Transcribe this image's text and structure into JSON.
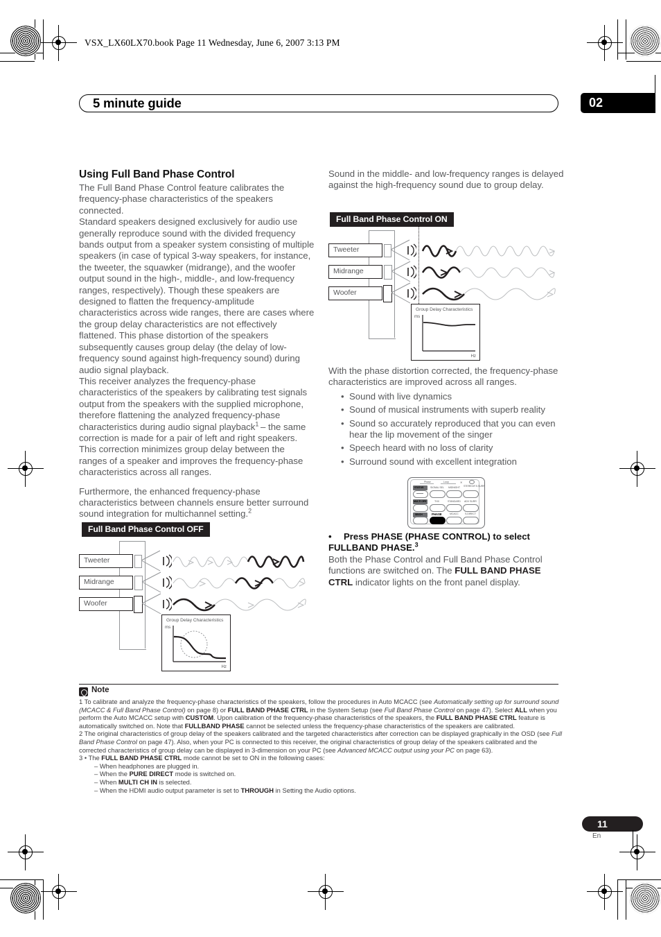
{
  "book_header": "VSX_LX60LX70.book  Page 11  Wednesday, June 6, 2007  3:13 PM",
  "chapter": {
    "title": "5 minute guide",
    "number": "02"
  },
  "page_footer": {
    "number": "11",
    "lang": "En"
  },
  "left_column": {
    "heading": "Using Full Band Phase Control",
    "paragraphs": [
      "The Full Band Phase Control feature calibrates the frequency-phase characteristics of the speakers connected.",
      "Standard speakers designed exclusively for audio use generally reproduce sound with the divided frequency bands output from a speaker system consisting of multiple speakers (in case of typical 3-way speakers, for instance, the tweeter, the squawker (midrange), and the woofer output sound in the high-, middle-, and low-frequency ranges, respectively). Though these speakers are designed to flatten the frequency-amplitude characteristics across wide ranges, there are cases where the group delay characteristics are not effectively flattened. This phase distortion of the speakers subsequently causes group delay (the delay of low-frequency sound against high-frequency sound) during audio signal playback.",
      "This receiver analyzes the frequency-phase characteristics of the speakers by calibrating test signals output from the speakers with the supplied microphone, therefore flattening the analyzed frequency-phase characteristics during audio signal playback",
      " – the same correction is made for a pair of left and right speakers. This correction minimizes group delay between the ranges of a speaker and improves the frequency-phase characteristics across all ranges.",
      "Furthermore, the enhanced frequency-phase characteristics between channels ensure better surround sound integration for multichannel setting."
    ],
    "footnote_marker_1": "1",
    "footnote_marker_2": "2",
    "figure_off": {
      "caption": "Full Band Phase Control OFF",
      "speakers": [
        "Tweeter",
        "Midrange",
        "Woofer"
      ],
      "graph_title": "Group Delay Characteristics",
      "y_axis": "ms",
      "x_axis": "Hz"
    }
  },
  "right_column": {
    "intro": "Sound in the middle- and low-frequency ranges is delayed against the high-frequency sound due to group delay.",
    "figure_on": {
      "caption": "Full Band Phase Control ON",
      "speakers": [
        "Tweeter",
        "Midrange",
        "Woofer"
      ],
      "graph_title": "Group Delay Characteristics",
      "y_axis": "ms",
      "x_axis": "Hz"
    },
    "after_figure": "With the phase distortion corrected, the frequency-phase characteristics are improved across all ranges.",
    "benefits": [
      "Sound with live dynamics",
      "Sound of musical instruments with superb reality",
      "Sound so accurately reproduced that you can even hear the lip movement of the singer",
      "Speech heard with no loss of clarity",
      "Surround sound with excellent integration"
    ],
    "remote": {
      "buttons": [
        "STATUS",
        "SIGNAL SEL",
        "MIDNIGHT",
        "STEREO/F.S.SURR",
        "MULTI OPE",
        "THX",
        "STANDARD",
        "ADV SURR",
        "SB/CH",
        "PHASE",
        "MCACC",
        "S.DIRECT"
      ],
      "top_labels": [
        "Phase",
        "Loop"
      ],
      "highlighted": "PHASE"
    },
    "step": {
      "bullet": "•",
      "text_bold_1": "Press PHASE (PHASE CONTROL) to select",
      "text_bold_2": "FULLBAND PHASE.",
      "marker": "3",
      "body_1": "Both the Phase Control and Full Band Phase Control functions are switched on. The ",
      "body_bold": "FULL BAND PHASE CTRL",
      "body_2": " indicator lights on the front panel display."
    }
  },
  "note": {
    "title": "Note",
    "items": [
      {
        "num": "1",
        "runs": [
          {
            "t": "1 To calibrate and analyze the frequency-phase characteristics of the speakers, follow the procedures in Auto MCACC (see ",
            "s": "n"
          },
          {
            "t": "Automatically setting up for surround sound (MCACC & Full Band Phase Control)",
            "s": "i"
          },
          {
            "t": " on page 8) or ",
            "s": "n"
          },
          {
            "t": "FULL BAND PHASE CTRL",
            "s": "b"
          },
          {
            "t": " in the System Setup (see ",
            "s": "n"
          },
          {
            "t": "Full Band Phase Control",
            "s": "i"
          },
          {
            "t": " on page 47). Select ",
            "s": "n"
          },
          {
            "t": "ALL",
            "s": "b"
          },
          {
            "t": " when you perform the Auto MCACC setup with ",
            "s": "n"
          },
          {
            "t": "CUSTOM",
            "s": "b"
          },
          {
            "t": ". Upon calibration of the frequency-phase characteristics of the speakers, the ",
            "s": "n"
          },
          {
            "t": "FULL BAND PHASE CTRL",
            "s": "b"
          },
          {
            "t": " feature is automatically switched on. Note that ",
            "s": "n"
          },
          {
            "t": "FULLBAND PHASE",
            "s": "b"
          },
          {
            "t": " cannot be selected unless the frequency-phase characteristics of the speakers are calibrated.",
            "s": "n"
          }
        ]
      },
      {
        "num": "2",
        "runs": [
          {
            "t": "2 The original characteristics of group delay of the speakers calibrated and the targeted characteristics after correction can be displayed graphically in the OSD (see ",
            "s": "n"
          },
          {
            "t": "Full Band Phase Control",
            "s": "i"
          },
          {
            "t": " on page 47). Also, when your PC is connected to this receiver, the original characteristics of group delay of the speakers calibrated and the corrected characteristics of group delay can be displayed in 3-dimension on your PC (see ",
            "s": "n"
          },
          {
            "t": "Advanced MCACC output using your PC",
            "s": "i"
          },
          {
            "t": " on page 63).",
            "s": "n"
          }
        ]
      },
      {
        "num": "3",
        "runs": [
          {
            "t": "3 • The ",
            "s": "n"
          },
          {
            "t": "FULL BAND PHASE CTRL",
            "s": "b"
          },
          {
            "t": " mode cannot be set to ON in the following cases:",
            "s": "n"
          }
        ]
      }
    ],
    "sub_items": [
      [
        {
          "t": "– When headphones are plugged in.",
          "s": "n"
        }
      ],
      [
        {
          "t": "– When the ",
          "s": "n"
        },
        {
          "t": "PURE DIRECT",
          "s": "b"
        },
        {
          "t": " mode is switched on.",
          "s": "n"
        }
      ],
      [
        {
          "t": "– When ",
          "s": "n"
        },
        {
          "t": "MULTI CH IN",
          "s": "b"
        },
        {
          "t": " is selected.",
          "s": "n"
        }
      ],
      [
        {
          "t": "– When the HDMI audio output parameter is set to ",
          "s": "n"
        },
        {
          "t": "THROUGH",
          "s": "b"
        },
        {
          "t": " in Setting the Audio options.",
          "s": "n"
        }
      ]
    ]
  }
}
